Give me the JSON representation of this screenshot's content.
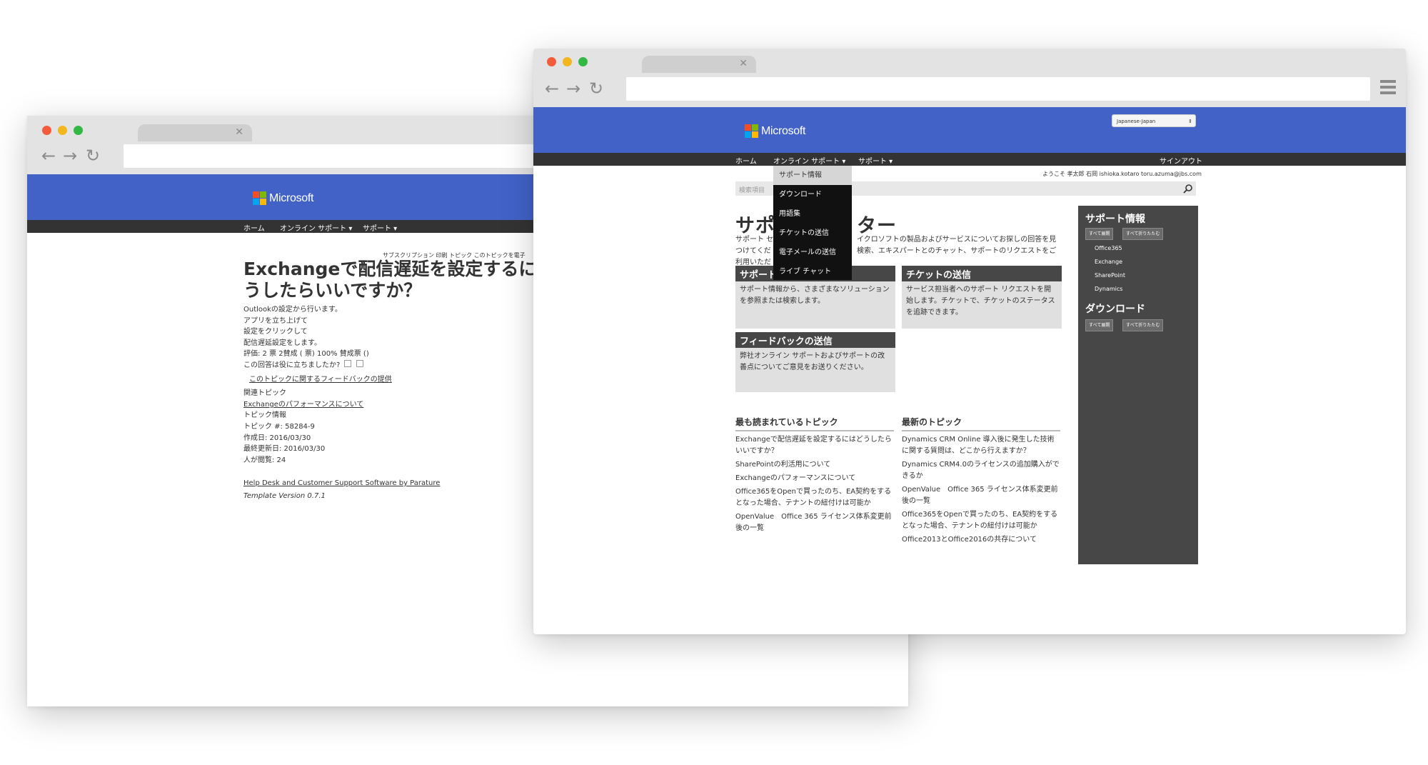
{
  "back_window": {
    "logo_text": "Microsoft",
    "nav": [
      "ホーム",
      "オンライン サポート ▾",
      "サポート ▾"
    ],
    "toolbar_links": "サブスクリプション 印刷 トピック このトピックを電子",
    "title_line1": "Exchangeで配信遅延を設定するには",
    "title_line2": "うしたらいいですか？",
    "body_lines": [
      "Outlookの設定から行います。",
      "アプリを立ち上げて",
      "設定をクリックして",
      "配信遅延設定をします。",
      "評価: 2 票 2賛成 ( 票) 100% 賛成票 ()",
      "この回答は役に立ちましたか?"
    ],
    "feedback_link": "このトピックに関するフィードバックの提供",
    "related_label": "関連トピック",
    "related_link": "Exchangeのパフォーマンスについて",
    "info_lines": [
      "トピック情報",
      "トピック #: 58284-9",
      "作成日: 2016/03/30",
      "最終更新日: 2016/03/30",
      "人が閲覧: 24"
    ],
    "footer_link": "Help Desk and Customer Support Software by Parature",
    "template_version": "Template Version 0.7.1"
  },
  "front_window": {
    "logo_text": "Microsoft",
    "language_select": "Japanese-Japan",
    "nav": {
      "home": "ホーム",
      "online_support": "オンライン サポート ▾",
      "support": "サポート ▾",
      "sign_out": "サインアウト"
    },
    "greeting": "ようこそ 孝太郎 石岡 ishioka.kotaro toru.azuma@jbs.com",
    "search_placeholder": "検索項目",
    "page_title_left": "サポ",
    "page_title_right": "ター",
    "intro_left": [
      "サポート セ",
      "つけてくだ",
      "利用いただ"
    ],
    "intro_right": [
      "イクロソフトの製品およびサービスについてお探しの回答を見",
      "検索、エキスパートとのチャット、サポートのリクエストをご"
    ],
    "dropdown": [
      "サポート情報",
      "ダウンロード",
      "用語集",
      "チケットの送信",
      "電子メールの送信",
      "ライブ チャット"
    ],
    "cards": [
      {
        "title": "サポート情報",
        "body": "サポート情報から、さまざまなソリューションを参照または検索します。"
      },
      {
        "title": "チケットの送信",
        "body": "サービス担当者へのサポート リクエストを開始します。チケットで、チケットのステータスを追跡できます。"
      },
      {
        "title": "フィードバックの送信",
        "body": "弊社オンライン サポートおよびサポートの改善点についてご意見をお送りください。"
      }
    ],
    "popular": {
      "title": "最も読まれているトピック",
      "items": [
        "Exchangeで配信遅延を設定するにはどうしたらいいですか？",
        "SharePointの利活用について",
        "Exchangeのパフォーマンスについて",
        "Office365をOpenで買ったのち、EA契約をするとなった場合、テナントの紐付けは可能か",
        "OpenValue　Office 365 ライセンス体系変更前後の一覧"
      ]
    },
    "latest": {
      "title": "最新のトピック",
      "items": [
        "Dynamics CRM Online 導入後に発生した技術に関する質問は、どこから行えますか？",
        "Dynamics CRM4.0のライセンスの追加購入ができるか",
        "OpenValue　Office 365 ライセンス体系変更前後の一覧",
        "Office365をOpenで買ったのち、EA契約をするとなった場合、テナントの紐付けは可能か",
        "Office2013とOffice2016の共存について"
      ]
    },
    "sidebar": {
      "kb_title": "サポート情報",
      "expand_all": "すべて展開",
      "collapse_all": "すべて折りたたむ",
      "kb_items": [
        "Office365",
        "Exchange",
        "SharePoint",
        "Dynamics"
      ],
      "download_title": "ダウンロード",
      "expand_all_2": "すべて展開",
      "collapse_all_2": "すべて折りたたむ"
    }
  },
  "colors": {
    "ms_blue": "#4262c8",
    "nav_dark": "#333333",
    "sidebar": "#474747",
    "card_bg": "#e0e0e0",
    "logo_red": "#f25022",
    "logo_green": "#7fba00",
    "logo_blue": "#00a4ef",
    "logo_yellow": "#ffb900"
  }
}
